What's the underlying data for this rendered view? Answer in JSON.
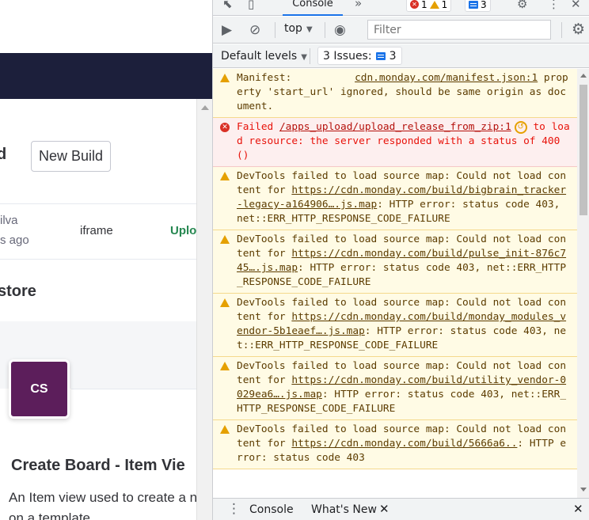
{
  "app": {
    "title_partial": "d",
    "new_build_label": "New Build",
    "row": {
      "name_partial": "ilva",
      "time_partial": "s ago",
      "type": "iframe",
      "status_partial": "Uplo"
    },
    "section_title_partial": "store",
    "card": {
      "avatar_initials": "CS",
      "title": "Create Board - Item Vie",
      "description": "An Item view used to create a n based on a template"
    }
  },
  "devtools": {
    "tabs": {
      "active": "Console",
      "more": "»",
      "error_count": "1",
      "warning_count": "1",
      "issue_count": "3"
    },
    "toolbar": {
      "context": "top",
      "filter_placeholder": "Filter"
    },
    "levels": {
      "label": "Default levels",
      "issues_label": "3 Issues:",
      "issues_count": "3"
    },
    "messages": [
      {
        "level": "warning",
        "text_before": "Manifest:",
        "source": "cdn.monday.com/manifest.json:1",
        "text_after": "property 'start_url' ignored, should be same origin as document."
      },
      {
        "level": "error",
        "text_before": "Failed",
        "source": "/apps_upload/upload_release_from_zip:1",
        "text_after": "to load resource: the server responded with a status of 400 ()"
      },
      {
        "level": "warning",
        "text_before": "DevTools failed to load source map: Could not load content for",
        "source": "https://cdn.monday.com/build/bigbrain_tracker-legacy-a164906….js.map",
        "text_after": ": HTTP error: status code 403, net::ERR_HTTP_RESPONSE_CODE_FAILURE"
      },
      {
        "level": "warning",
        "text_before": "DevTools failed to load source map: Could not load content for",
        "source": "https://cdn.monday.com/build/pulse_init-876c745….js.map",
        "text_after": ": HTTP error: status code 403, net::ERR_HTTP_RESPONSE_CODE_FAILURE"
      },
      {
        "level": "warning",
        "text_before": "DevTools failed to load source map: Could not load content for",
        "source": "https://cdn.monday.com/build/monday_modules_vendor-5b1eaef….js.map",
        "text_after": ": HTTP error: status code 403, net::ERR_HTTP_RESPONSE_CODE_FAILURE"
      },
      {
        "level": "warning",
        "text_before": "DevTools failed to load source map: Could not load content for",
        "source": "https://cdn.monday.com/build/utility_vendor-0029ea6….js.map",
        "text_after": ": HTTP error: status code 403, net::ERR_HTTP_RESPONSE_CODE_FAILURE"
      },
      {
        "level": "warning",
        "text_before": "DevTools failed to load source map: Could not load content for",
        "source": "https://cdn.monday.com/build/5666a6..",
        "text_after": ": HTTP error: status code 403"
      }
    ],
    "drawer": {
      "tab1": "Console",
      "tab2": "What's New"
    }
  }
}
